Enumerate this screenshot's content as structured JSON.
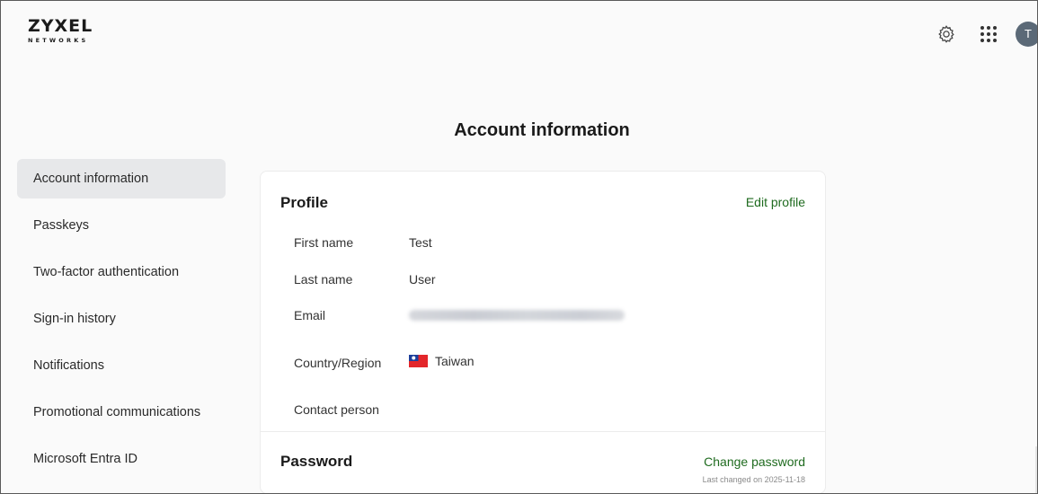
{
  "header": {
    "logo_main": "ZYXEL",
    "logo_sub": "NETWORKS",
    "settings_icon": "gear-icon",
    "apps_icon": "grid-icon",
    "avatar_initial": "T"
  },
  "page": {
    "title": "Account information"
  },
  "sidebar": {
    "items": [
      {
        "label": "Account information",
        "active": true
      },
      {
        "label": "Passkeys"
      },
      {
        "label": "Two-factor authentication"
      },
      {
        "label": "Sign-in history"
      },
      {
        "label": "Notifications"
      },
      {
        "label": "Promotional communications"
      },
      {
        "label": "Microsoft Entra ID"
      }
    ]
  },
  "profile": {
    "title": "Profile",
    "edit_link": "Edit profile",
    "fields": {
      "first_name_label": "First name",
      "first_name_value": "Test",
      "last_name_label": "Last name",
      "last_name_value": "User",
      "email_label": "Email",
      "country_label": "Country/Region",
      "country_value": "Taiwan",
      "contact_label": "Contact person"
    }
  },
  "password": {
    "title": "Password",
    "change_link": "Change password",
    "last_changed": "Last changed on 2025-11-18"
  },
  "colors": {
    "link_green": "#1f6b1f",
    "active_bg": "#e7e8ea",
    "avatar_bg": "#5b6977"
  }
}
